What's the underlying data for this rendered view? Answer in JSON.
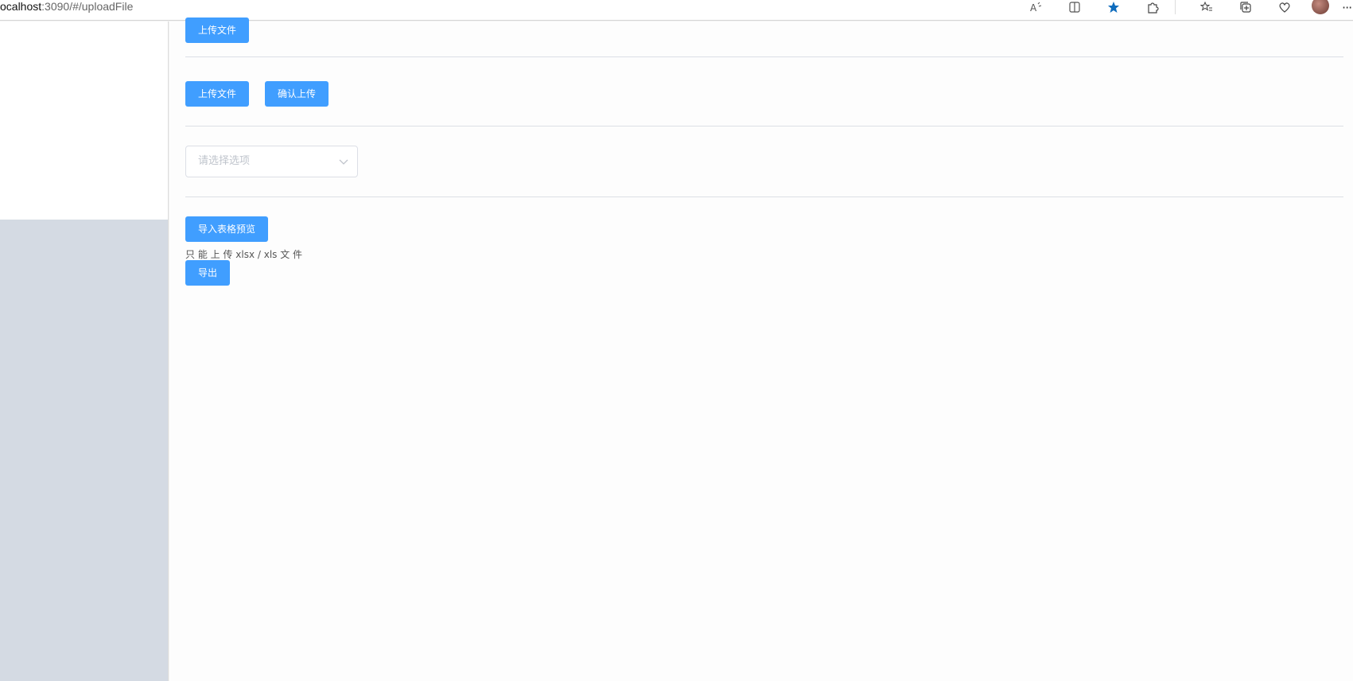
{
  "browser": {
    "url_prefix": "ocalhost",
    "url_rest": ":3090/#/uploadFile",
    "icons": [
      "read-aloud-icon",
      "split-screen-icon",
      "favorite-star-icon",
      "extensions-icon",
      "favorites-icon",
      "collections-icon",
      "browser-essentials-icon",
      "profile-avatar",
      "more-icon"
    ],
    "accent": "#0f6cbd"
  },
  "main": {
    "upload_button_1": "上传文件",
    "upload_button_2": "上传文件",
    "confirm_upload_button": "确认上传",
    "select": {
      "placeholder": "请选择选项"
    },
    "import_preview_button": "导入表格预览",
    "upload_tip": "只 能 上 传 xlsx / xls 文 件",
    "export_button": "导出"
  },
  "colors": {
    "primary": "#409eff",
    "sidebar": "#d4dae3",
    "divider": "#dcdfe6"
  }
}
